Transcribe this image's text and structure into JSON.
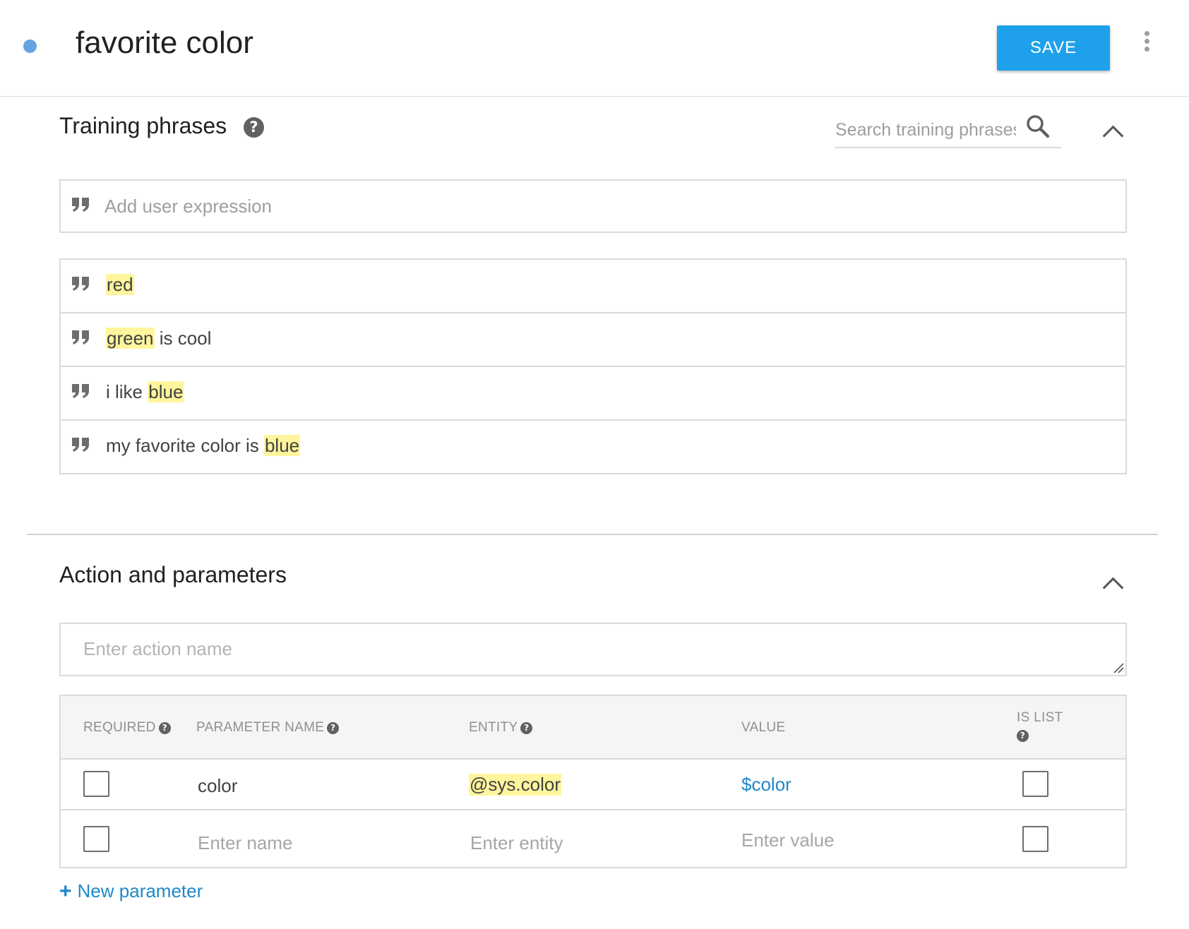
{
  "header": {
    "title": "favorite color",
    "save_label": "SAVE"
  },
  "training": {
    "heading": "Training phrases",
    "search_placeholder": "Search training phrases",
    "add_placeholder": "Add user expression",
    "phrases": [
      {
        "parts": [
          {
            "text": "red",
            "annotated": true
          }
        ]
      },
      {
        "parts": [
          {
            "text": "green",
            "annotated": true
          },
          {
            "text": " is cool",
            "annotated": false
          }
        ]
      },
      {
        "parts": [
          {
            "text": "i like ",
            "annotated": false
          },
          {
            "text": "blue",
            "annotated": true
          }
        ]
      },
      {
        "parts": [
          {
            "text": "my favorite color is ",
            "annotated": false
          },
          {
            "text": "blue",
            "annotated": true
          }
        ]
      }
    ]
  },
  "action": {
    "heading": "Action and parameters",
    "action_placeholder": "Enter action name",
    "columns": {
      "required": "REQUIRED",
      "parameter_name": "PARAMETER NAME",
      "entity": "ENTITY",
      "value": "VALUE",
      "is_list": "IS LIST"
    },
    "rows": [
      {
        "required": false,
        "name": "color",
        "entity": "@sys.color",
        "value": "$color",
        "is_list": false
      }
    ],
    "empty_row": {
      "name_placeholder": "Enter name",
      "entity_placeholder": "Enter entity",
      "value_placeholder": "Enter value"
    },
    "new_parameter_label": "New parameter",
    "new_parameter_glyph": "+"
  },
  "icons": {
    "help_glyph": "?"
  },
  "colors": {
    "status_dot": "#63a4e2",
    "save_button": "#1fa0ea",
    "link": "#1e88c8",
    "highlight": "#fff59d"
  }
}
